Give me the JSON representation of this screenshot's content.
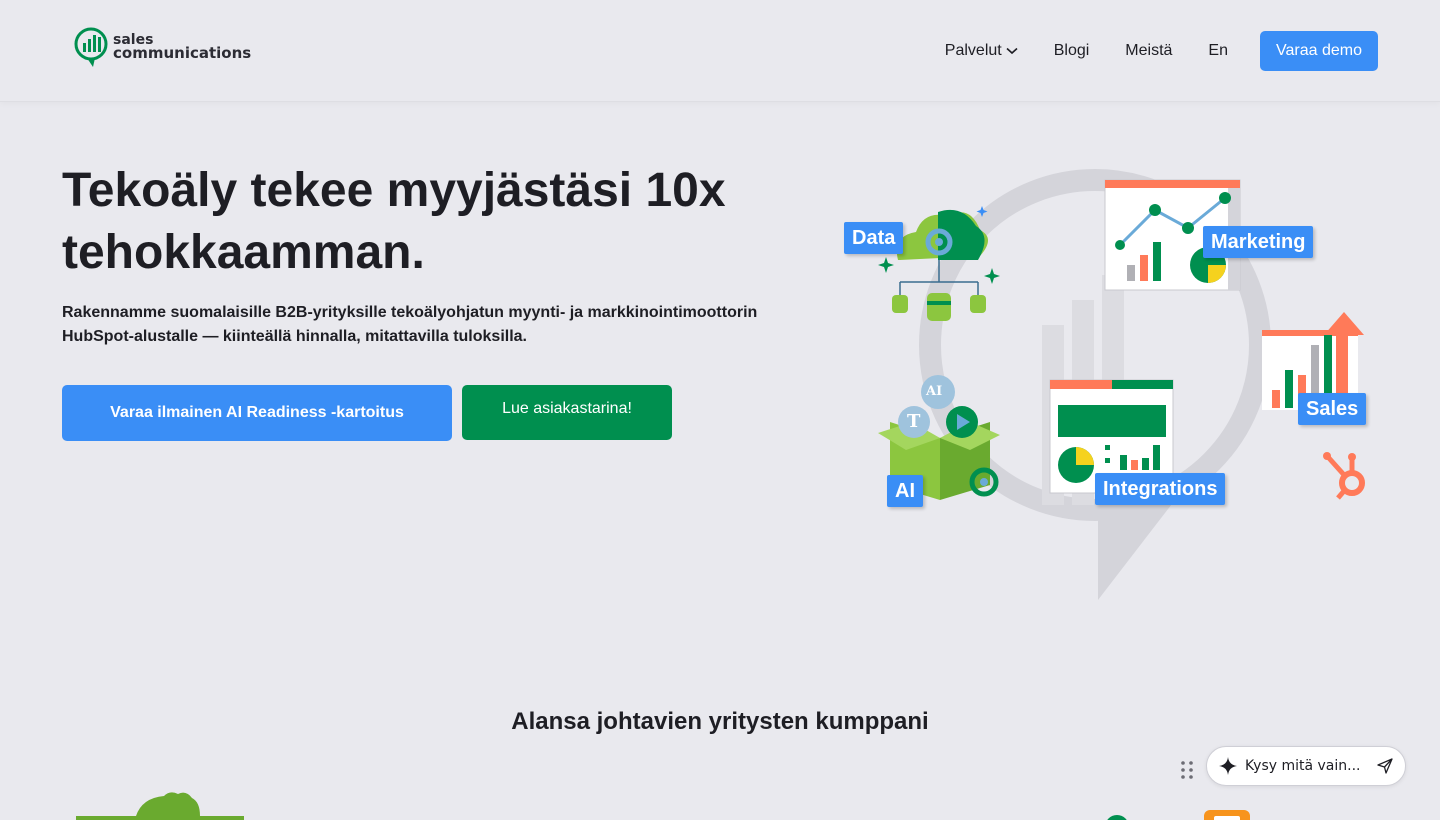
{
  "header": {
    "logo": {
      "line1": "sales",
      "line2": "communications"
    },
    "nav": [
      {
        "label": "Palvelut",
        "has_dropdown": true
      },
      {
        "label": "Blogi"
      },
      {
        "label": "Meistä"
      },
      {
        "label": "En"
      }
    ],
    "cta_label": "Varaa demo"
  },
  "hero": {
    "title_line1": "Tekoäly tekee myyjästäsi 10x",
    "title_line2": "tehokkaamman.",
    "subtitle_line1": "Rakennamme suomalaisille B2B-yrityksille tekoälyohjatun myynti- ja markkinointimoottorin",
    "subtitle_line2": "HubSpot-alustalle — kiinteällä hinnalla, mitattavilla tuloksilla.",
    "primary_button": "Varaa ilmainen AI Readiness -kartoitus",
    "secondary_button": "Lue asiakastarina!"
  },
  "illustration": {
    "tags": {
      "data": "Data",
      "marketing": "Marketing",
      "sales": "Sales",
      "ai": "AI",
      "integrations": "Integrations",
      "ai_badge": "AI",
      "t_badge": "T"
    }
  },
  "partners": {
    "title": "Alansa johtavien yritysten kumppani"
  },
  "chat": {
    "placeholder": "Kysy mitä vain..."
  },
  "colors": {
    "accent_blue": "#3a8ef6",
    "brand_green": "#008f4f",
    "orange": "#ff7a59",
    "background": "#e9e9ee"
  }
}
